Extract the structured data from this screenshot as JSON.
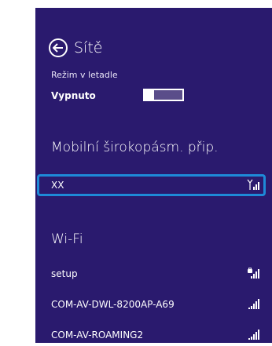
{
  "header": {
    "title": "Sítě"
  },
  "airplane_mode": {
    "label": "Režim v letadle",
    "state": "Vypnuto",
    "on": false
  },
  "mobile": {
    "section_title": "Mobilní širokopásm. přip.",
    "networks": [
      {
        "name": "XX",
        "signal_icon": "cellular-signal-icon",
        "selected": true
      }
    ]
  },
  "wifi": {
    "section_title": "Wi-Fi",
    "networks": [
      {
        "name": "setup",
        "signal_icon": "wifi-signal-secured-icon"
      },
      {
        "name": "COM-AV-DWL-8200AP-A69",
        "signal_icon": "wifi-signal-icon"
      },
      {
        "name": "COM-AV-ROAMING2",
        "signal_icon": "wifi-signal-icon"
      }
    ]
  },
  "colors": {
    "panel_bg": "#2a1a6e",
    "focus_border": "#1e8ad8",
    "text": "#ffffff"
  }
}
